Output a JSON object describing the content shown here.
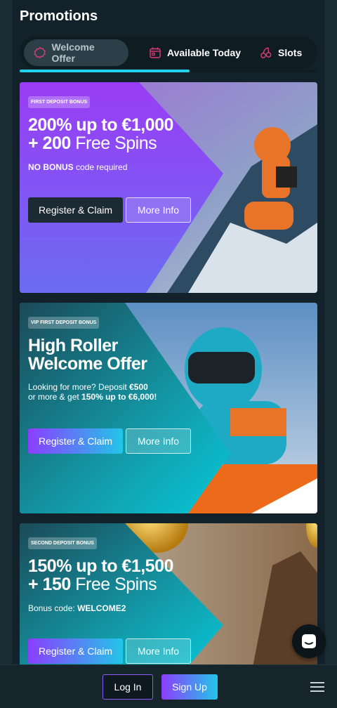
{
  "page": {
    "title": "Promotions"
  },
  "tabs": [
    {
      "label": "Welcome Offer",
      "icon": "badge-icon",
      "active": true
    },
    {
      "label": "Available Today",
      "icon": "calendar-icon",
      "active": false
    },
    {
      "label": "Slots",
      "icon": "cherries-icon",
      "active": false
    }
  ],
  "tab_progress": 0.57,
  "cards": [
    {
      "badge": "FIRST DEPOSIT BONUS",
      "headline_line1": "200% up to €1,000",
      "headline_line2_bold": "+ 200",
      "headline_line2_light": "Free Spins",
      "sub_bold": "NO BONUS",
      "sub_text": "code required",
      "claim_label": "Register & Claim",
      "more_label": "More Info"
    },
    {
      "badge": "VIP FIRST DEPOSIT BONUS",
      "headline_line1": "High Roller",
      "headline_line2": "Welcome Offer",
      "sub_line1_text": "Looking for more? Deposit",
      "sub_line1_bold": "€500",
      "sub_line2_text": "or more & get",
      "sub_line2_bold": "150% up to €6,000!",
      "claim_label": "Register & Claim",
      "more_label": "More Info"
    },
    {
      "badge": "SECOND DEPOSIT BONUS",
      "headline_line1": "150% up to €1,500",
      "headline_line2_bold": "+ 150",
      "headline_line2_light": "Free Spins",
      "sub_text": "Bonus code:",
      "sub_bold": "WELCOME2",
      "claim_label": "Register & Claim",
      "more_label": "More Info"
    }
  ],
  "bottom": {
    "login_label": "Log In",
    "signup_label": "Sign Up"
  },
  "colors": {
    "accent_cyan": "#22d3ee",
    "accent_purple": "#8b3dff",
    "tab_icon_pink": "#e23a74"
  }
}
